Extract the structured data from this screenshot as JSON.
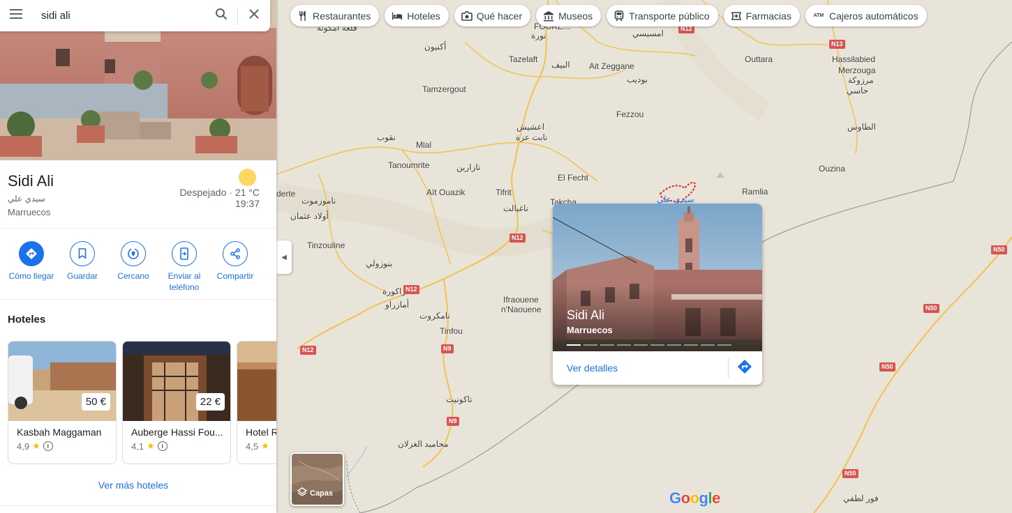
{
  "search": {
    "query": "sidi ali"
  },
  "place": {
    "title": "Sidi Ali",
    "arabic_name": "سيدي علي",
    "country": "Marruecos",
    "weather_text": "Despejado · 21 °C",
    "time": "19:37"
  },
  "actions": [
    {
      "label": "Cómo llegar",
      "icon": "directions-icon"
    },
    {
      "label": "Guardar",
      "icon": "bookmark-icon"
    },
    {
      "label": "Cercano",
      "icon": "nearby-icon"
    },
    {
      "label": "Enviar al teléfono",
      "icon": "send-to-phone-icon"
    },
    {
      "label": "Compartir",
      "icon": "share-icon"
    }
  ],
  "hotels": {
    "heading": "Hoteles",
    "items": [
      {
        "name": "Kasbah Maggaman",
        "rating": "4,9",
        "price": "50 €"
      },
      {
        "name": "Auberge Hassi Fou...",
        "rating": "4,1",
        "price": "22 €"
      },
      {
        "name": "Hotel R",
        "rating": "4,5",
        "price": ""
      }
    ],
    "more_label": "Ver más hoteles"
  },
  "chips": [
    {
      "label": "Restaurantes",
      "icon": "fork-knife-icon"
    },
    {
      "label": "Hoteles",
      "icon": "bed-icon"
    },
    {
      "label": "Qué hacer",
      "icon": "camera-icon"
    },
    {
      "label": "Museos",
      "icon": "museum-icon"
    },
    {
      "label": "Transporte público",
      "icon": "train-icon"
    },
    {
      "label": "Farmacias",
      "icon": "pharmacy-icon"
    },
    {
      "label": "Cajeros automáticos",
      "icon": "atm-icon"
    }
  ],
  "popup": {
    "title": "Sidi Ali",
    "subtitle": "Marruecos",
    "details_label": "Ver detalles"
  },
  "layers": {
    "label": "Capas"
  },
  "logo": {
    "text": "Google"
  },
  "colors": {
    "accent": "#1a73e8",
    "road_shield": "#d9534f",
    "road": "#f2c14e",
    "map_bg": "#e9e4d9"
  },
  "map": {
    "places": [
      "أكنيون",
      "قلعة أمكونة",
      "Tazelaft",
      "البيف",
      "Ait Zeggane",
      "بوديب",
      "Outtara",
      "Hassilabied",
      "Merzouga",
      "مرزوكة",
      "حاسي",
      "Tamzergout",
      "Fezzou",
      "الطاوس",
      "اعشيش",
      "نابت عزة",
      "نقوب",
      "Mlal",
      "Tanoumrite",
      "تازارين",
      "El Fecht",
      "Ouzina",
      "Aït Ouazik",
      "Tifrit",
      "Takcha",
      "Ramlia",
      "derte",
      "ناموزموت",
      "أولاد عثمان",
      "ناغبالت",
      "Tinzouline",
      "بنوزولي",
      "زاكورة",
      "أمازراو",
      "نامكروت",
      "Ifraouene",
      "n'Naouene",
      "Tinfou",
      "تاكونيت",
      "محاميد الغزلان",
      "فور لطفي",
      "امسيسي",
      "نورة",
      "FOURE..."
    ],
    "roads": [
      "N12",
      "N12",
      "N12",
      "N12",
      "N9",
      "N9",
      "N13",
      "N50",
      "N50",
      "N50",
      "N50"
    ],
    "target_label": "سيدي علي"
  }
}
